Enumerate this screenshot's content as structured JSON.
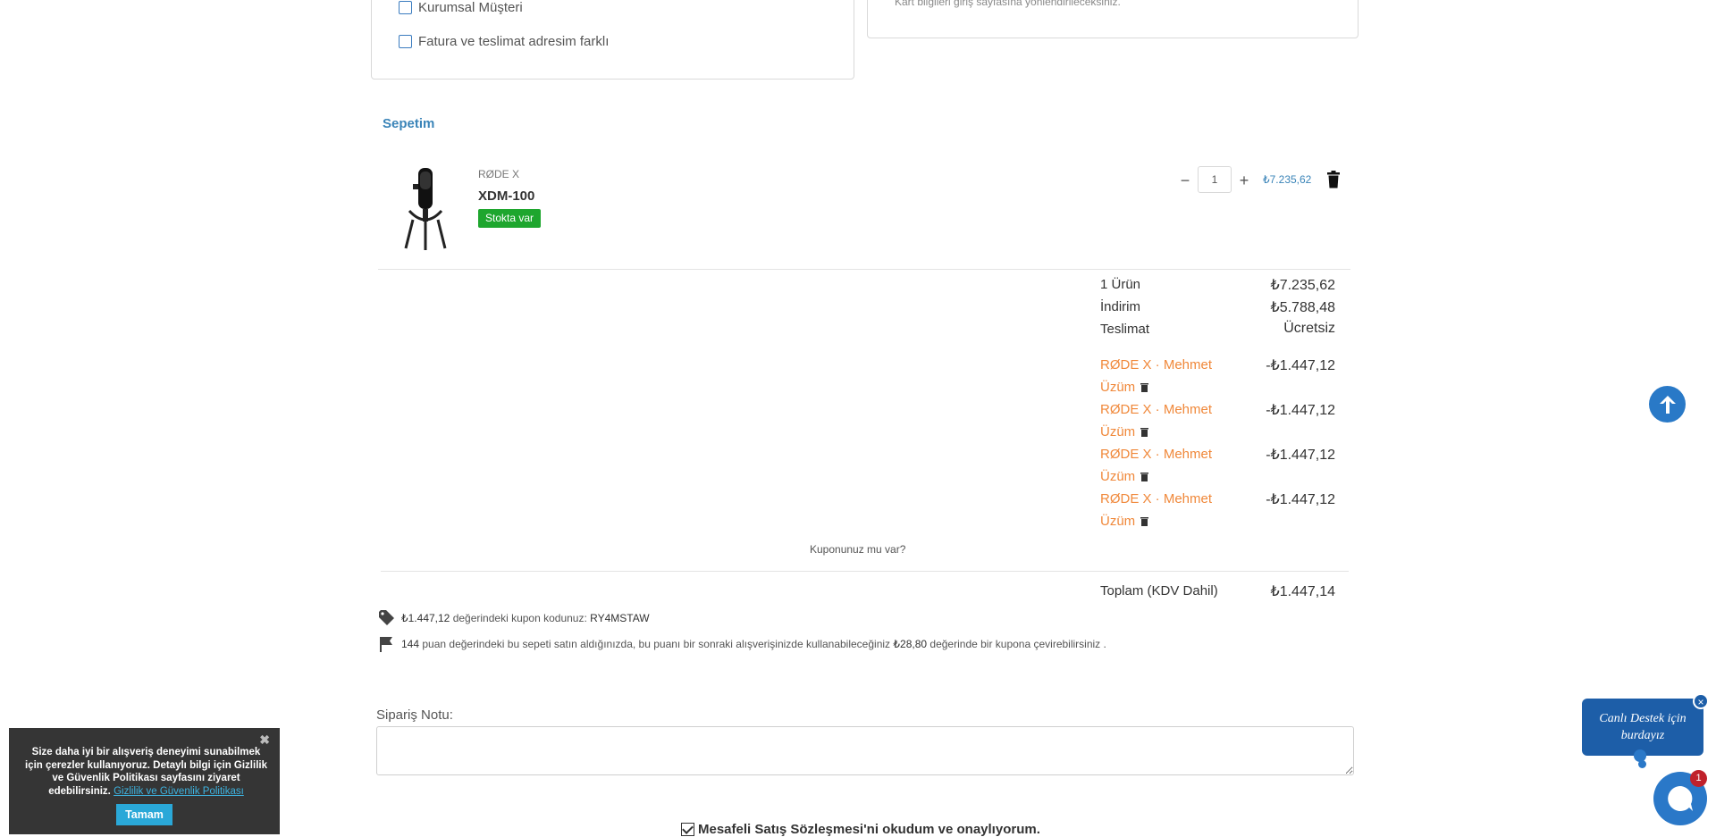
{
  "customer_form": {
    "corporate_label": "Kurumsal Müşteri",
    "diff_address_label": "Fatura ve teslimat adresim farklı",
    "card_hint": "Kart bilgileri giriş sayfasına yönlendirileceksiniz."
  },
  "cart": {
    "title": "Sepetim",
    "item": {
      "brand": "RØDE X",
      "name": "XDM-100",
      "stock": "Stokta var",
      "quantity": "1",
      "price": "₺7.235,62",
      "minus": "−",
      "plus": "+"
    },
    "summary": [
      {
        "label": "1 Ürün",
        "value": "₺7.235,62"
      },
      {
        "label": "İndirim",
        "value": "₺5.788,48"
      },
      {
        "label": "Teslimat",
        "value": "Ücretsiz"
      }
    ],
    "discounts": [
      {
        "label": "RØDE X · Mehmet Üzüm",
        "value": "-₺1.447,12"
      },
      {
        "label": "RØDE X · Mehmet Üzüm",
        "value": "-₺1.447,12"
      },
      {
        "label": "RØDE X · Mehmet Üzüm",
        "value": "-₺1.447,12"
      },
      {
        "label": "RØDE X · Mehmet Üzüm",
        "value": "-₺1.447,12"
      }
    ],
    "coupon_link": "Kuponunuz mu var?",
    "total_label": "Toplam (KDV Dahil)",
    "total_value": "₺1.447,14"
  },
  "info": {
    "coupon_amount": "₺1.447,12",
    "coupon_text": "değerindeki kupon kodunuz:",
    "coupon_code": "RY4MSTAW",
    "points": "144",
    "points_text": "puan değerindeki bu sepeti satın aldığınızda, bu puanı bir sonraki alışverişinizde kullanabileceğiniz",
    "points_value": "₺28,80",
    "points_tail": "değerinde bir kupona çevirebilirsiniz ."
  },
  "order_note": {
    "label": "Sipariş Notu:"
  },
  "agreement": {
    "label": "Mesafeli Satış Sözleşmesi'ni okudum ve onaylıyorum."
  },
  "chat": {
    "bubble": "Canlı Destek için burdayız",
    "close": "×",
    "badge": "1"
  },
  "cookie": {
    "text": "Size daha iyi bir alışveriş deneyimi sunabilmek için çerezler kullanıyoruz. Detaylı bilgi için Gizlilik ve Güvenlik Politikası sayfasını ziyaret edebilirsiniz.",
    "link": "Gizlilik ve Güvenlik Politikası",
    "ok": "Tamam",
    "close": "✖"
  },
  "colors": {
    "accent": "#3a84b8",
    "stock_green": "#1ea62e",
    "discount_orange": "#f0883a",
    "chat_blue": "#1d5ea8",
    "cookie_bg": "#353535"
  }
}
